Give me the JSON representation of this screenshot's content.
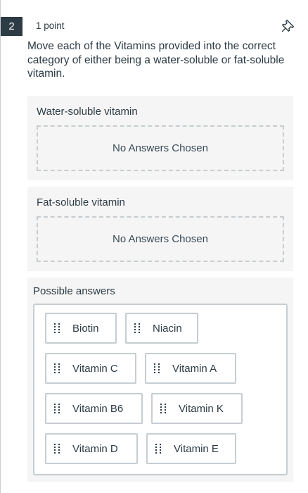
{
  "question": {
    "number": "2",
    "points": "1 point",
    "prompt": "Move each of the Vitamins provided into the correct category of either being a water-soluble or fat-soluble vitamin.",
    "pin_icon": "pin-icon"
  },
  "categories": [
    {
      "title": "Water-soluble vitamin",
      "empty_text": "No Answers Chosen"
    },
    {
      "title": "Fat-soluble vitamin",
      "empty_text": "No Answers Chosen"
    }
  ],
  "possible_answers": {
    "title": "Possible answers",
    "grip_icon": "drag-handle-icon",
    "items": [
      "Biotin",
      "Niacin",
      "Vitamin C",
      "Vitamin A",
      "Vitamin B6",
      "Vitamin K",
      "Vitamin D",
      "Vitamin E"
    ]
  },
  "colors": {
    "text": "#2d3b45",
    "badge_bg": "#2d3b45",
    "panel_bg": "#f5f5f5",
    "border": "#c7cdd1"
  }
}
